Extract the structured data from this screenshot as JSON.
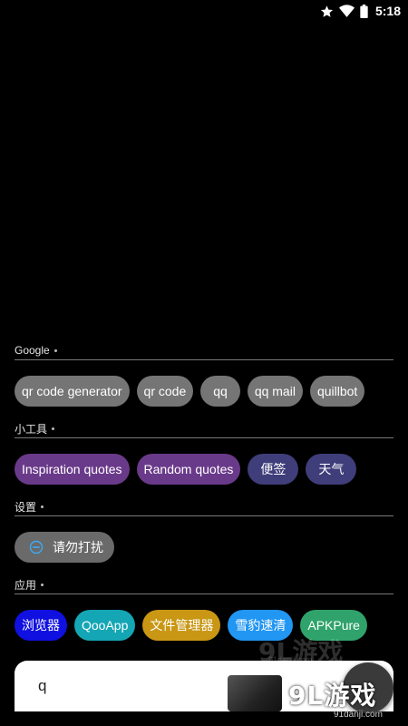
{
  "status_bar": {
    "time": "5:18",
    "icons": [
      "star-icon",
      "wifi-icon",
      "battery-icon"
    ]
  },
  "sections": [
    {
      "title": "Google",
      "chips": [
        "qr code generator",
        "qr code",
        "qq",
        "qq mail",
        "quillbot"
      ]
    },
    {
      "title": "小工具",
      "chips": [
        "Inspiration quotes",
        "Random quotes",
        "便签",
        "天气"
      ]
    },
    {
      "title": "设置",
      "chips": [
        "请勿打扰"
      ]
    },
    {
      "title": "应用",
      "chips": [
        "浏览器",
        "QooApp",
        "文件管理器",
        "雪豹速清",
        "APKPure"
      ]
    }
  ],
  "search": {
    "value": "q"
  },
  "watermark": {
    "text": "9L游戏",
    "url": "91danji.com"
  },
  "colors": {
    "background": "#000000",
    "google_chip": "#757575",
    "tool_quote_chip": "#6a3a8a",
    "tool_chip": "#3f3d7a",
    "app_browser": "#1010e0",
    "app_qooapp": "#14a6b5",
    "app_files": "#c99714",
    "app_cleaner": "#2196f3",
    "app_apkpure": "#2fa36b"
  }
}
